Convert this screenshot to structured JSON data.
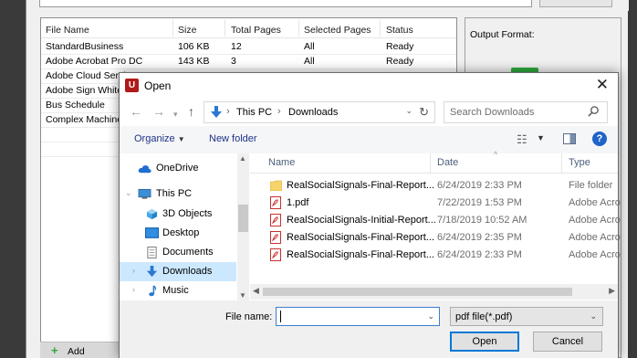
{
  "background_app": {
    "table_headers": [
      "File Name",
      "Size",
      "Total Pages",
      "Selected Pages",
      "Status"
    ],
    "rows": [
      {
        "name": "StandardBusiness",
        "size": "106 KB",
        "pages": "12",
        "selected": "All",
        "status": "Ready"
      },
      {
        "name": "Adobe Acrobat Pro DC",
        "size": "143 KB",
        "pages": "3",
        "selected": "All",
        "status": "Ready"
      },
      {
        "name": "Adobe Cloud Servi",
        "size": "",
        "pages": "",
        "selected": "",
        "status": ""
      },
      {
        "name": "Adobe Sign White",
        "size": "",
        "pages": "",
        "selected": "",
        "status": ""
      },
      {
        "name": "Bus Schedule",
        "size": "",
        "pages": "",
        "selected": "",
        "status": ""
      },
      {
        "name": "Complex Machine",
        "size": "",
        "pages": "",
        "selected": "",
        "status": ""
      }
    ],
    "output_format_label": "Output Format:",
    "add_label": "Add"
  },
  "dialog": {
    "title": "Open",
    "app_icon_letter": "U",
    "breadcrumb": [
      "This PC",
      "Downloads"
    ],
    "search_placeholder": "Search Downloads",
    "toolbar": {
      "organize": "Organize",
      "new_folder": "New folder"
    },
    "nav_items": [
      {
        "label": "OneDrive",
        "icon": "cloud-icon",
        "indent": 1
      },
      {
        "label": "This PC",
        "icon": "computer-icon",
        "indent": 0
      },
      {
        "label": "3D Objects",
        "icon": "cube-icon",
        "indent": 1
      },
      {
        "label": "Desktop",
        "icon": "desktop-icon",
        "indent": 1
      },
      {
        "label": "Documents",
        "icon": "documents-icon",
        "indent": 1
      },
      {
        "label": "Downloads",
        "icon": "download-icon",
        "indent": 1,
        "selected": true
      },
      {
        "label": "Music",
        "icon": "music-icon",
        "indent": 1
      }
    ],
    "columns": [
      "Name",
      "Date",
      "Type"
    ],
    "files": [
      {
        "name": "RealSocialSignals-Final-Report...",
        "date": "6/24/2019 2:33 PM",
        "type": "File folder",
        "icon": "folder-icon"
      },
      {
        "name": "1.pdf",
        "date": "7/22/2019 1:53 PM",
        "type": "Adobe Acro",
        "icon": "pdf-icon"
      },
      {
        "name": "RealSocialSignals-Initial-Report...",
        "date": "7/18/2019 10:52 AM",
        "type": "Adobe Acro",
        "icon": "pdf-icon"
      },
      {
        "name": "RealSocialSignals-Final-Report...",
        "date": "6/24/2019 2:35 PM",
        "type": "Adobe Acro",
        "icon": "pdf-icon"
      },
      {
        "name": "RealSocialSignals-Final-Report...",
        "date": "6/24/2019 2:33 PM",
        "type": "Adobe Acro",
        "icon": "pdf-icon"
      }
    ],
    "file_name_label": "File name:",
    "file_name_value": "",
    "file_type": "pdf file(*.pdf)",
    "open_button": "Open",
    "cancel_button": "Cancel"
  },
  "colors": {
    "accent": "#0078d7",
    "selection": "#cce8ff",
    "brand_icon": "#b11a1a",
    "green_button": "#2ea93a"
  }
}
